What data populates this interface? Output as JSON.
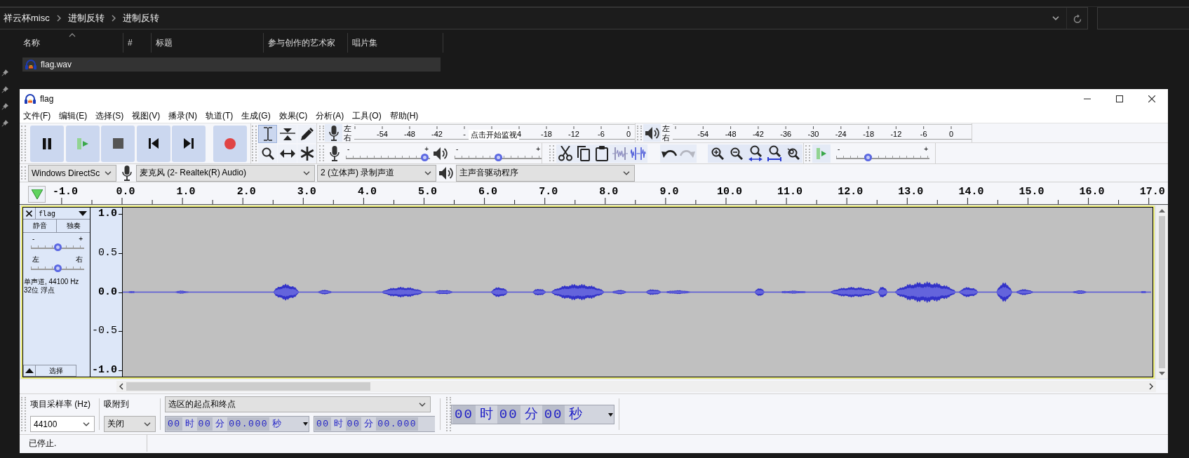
{
  "explorer": {
    "breadcrumb": [
      "祥云杯misc",
      "进制反转",
      "进制反转"
    ],
    "columns": [
      {
        "label": "名称",
        "sorted": true
      },
      {
        "label": "#",
        "sorted": false
      },
      {
        "label": "标题",
        "sorted": false
      },
      {
        "label": "参与创作的艺术家",
        "sorted": false
      },
      {
        "label": "唱片集",
        "sorted": false
      }
    ],
    "files": [
      {
        "name": "flag.wav",
        "selected": true
      }
    ]
  },
  "window": {
    "title": "flag"
  },
  "menu": [
    "文件(F)",
    "编辑(E)",
    "选择(S)",
    "视图(V)",
    "播录(N)",
    "轨道(T)",
    "生成(G)",
    "效果(C)",
    "分析(A)",
    "工具(O)",
    "帮助(H)"
  ],
  "tools": [
    {
      "kind": "select",
      "selected": true
    },
    {
      "kind": "envelope",
      "selected": false
    },
    {
      "kind": "draw",
      "selected": false
    },
    {
      "kind": "zoom",
      "selected": false
    },
    {
      "kind": "timeshift",
      "selected": false
    },
    {
      "kind": "multi",
      "selected": false
    }
  ],
  "record_meter": {
    "channels": [
      "左",
      "右"
    ],
    "ticks_before": [
      "-54",
      "-48",
      "-42",
      "-"
    ],
    "monitor_hint": "点击开始监视",
    "ticks_after": [
      "4",
      "-18",
      "-12",
      "-6",
      "0"
    ]
  },
  "playback_meter": {
    "channels": [
      "左",
      "右"
    ],
    "ticks": [
      "-54",
      "-48",
      "-42",
      "-36",
      "-30",
      "-24",
      "-18",
      "-12",
      "-6",
      "0"
    ]
  },
  "record_volume": {
    "min_label": "-",
    "max_label": "+",
    "level": 0.98
  },
  "playback_volume": {
    "min_label": "-",
    "max_label": "+",
    "level": 0.5
  },
  "undo_redo": [
    {
      "kind": "undo",
      "disabled": false
    },
    {
      "kind": "redo",
      "disabled": true
    }
  ],
  "play_at_speed": {
    "min_label": "-",
    "max_label": "+",
    "level": 0.33
  },
  "devices": {
    "host": "Windows DirectSc",
    "input": "麦克风 (2- Realtek(R) Audio)",
    "channels": "2 (立体声) 录制声道",
    "output": "主声音驱动程序"
  },
  "timeline": {
    "labels": [
      "-1.0",
      "0.0",
      "1.0",
      "2.0",
      "3.0",
      "4.0",
      "5.0",
      "6.0",
      "7.0",
      "8.0",
      "9.0",
      "10.0",
      "11.0",
      "12.0",
      "13.0",
      "14.0",
      "15.0",
      "16.0",
      "17.0"
    ]
  },
  "track": {
    "name": "flag",
    "focused": true,
    "mute": "静音",
    "solo": "独奏",
    "gain": {
      "min_label": "-",
      "max_label": "+",
      "level": 0.5
    },
    "pan": {
      "min_label": "左",
      "max_label": "右",
      "level": 0.5
    },
    "info": [
      "单声道, 44100 Hz",
      "32位 浮点"
    ],
    "select": "选择",
    "amplitude_labels": [
      {
        "text": "1.0",
        "major": true
      },
      {
        "text": "0.5",
        "major": false
      },
      {
        "text": "0.0",
        "major": true
      },
      {
        "text": "-0.5",
        "major": false
      },
      {
        "text": "-1.0",
        "major": true
      }
    ]
  },
  "selection_toolbar": {
    "rate_label": "项目采样率 (Hz)",
    "snap_label": "吸附到",
    "rate": "44100",
    "snap": "关闭",
    "mode": "选区的起点和终点",
    "start": [
      {
        "kind": "digits",
        "text": "00"
      },
      {
        "kind": "unit",
        "text": "时"
      },
      {
        "kind": "digits",
        "text": "00"
      },
      {
        "kind": "unit",
        "text": "分"
      },
      {
        "kind": "digits",
        "text": "00.000"
      },
      {
        "kind": "unit",
        "text": "秒"
      }
    ],
    "end": [
      {
        "kind": "digits",
        "text": "00"
      },
      {
        "kind": "unit",
        "text": "时"
      },
      {
        "kind": "digits",
        "text": "00"
      },
      {
        "kind": "unit",
        "text": "分"
      },
      {
        "kind": "digits",
        "text": "00.000"
      }
    ],
    "audio_position": [
      {
        "kind": "digits",
        "text": "00"
      },
      {
        "kind": "unit",
        "text": "时"
      },
      {
        "kind": "digits",
        "text": "00"
      },
      {
        "kind": "unit",
        "text": "分"
      },
      {
        "kind": "digits",
        "text": "00"
      },
      {
        "kind": "unit",
        "text": "秒"
      }
    ]
  },
  "status_bar": {
    "text": "已停止."
  }
}
